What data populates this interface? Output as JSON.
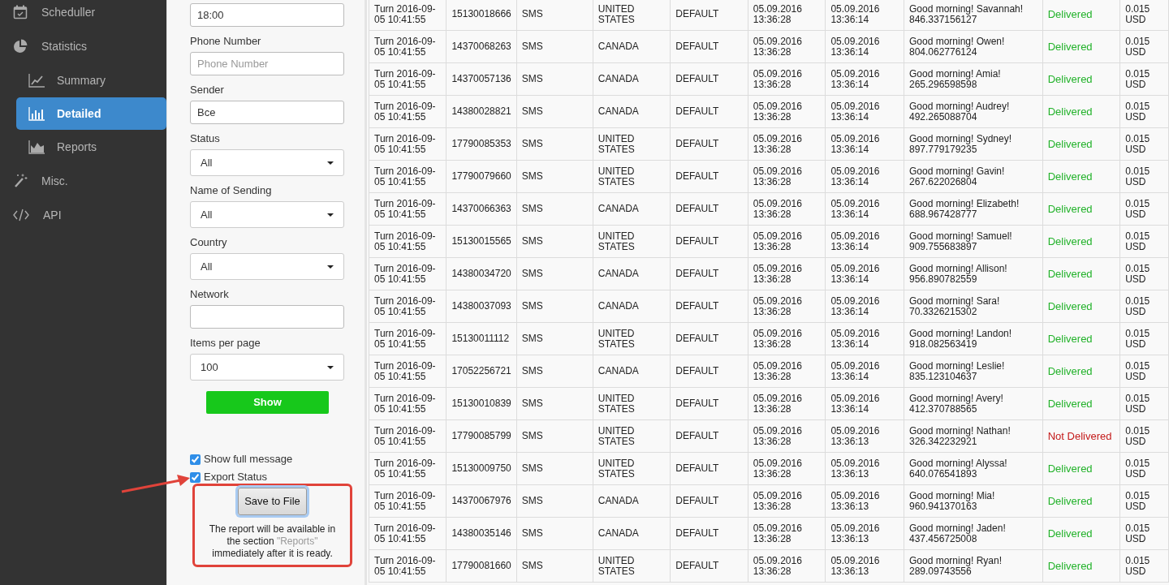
{
  "sidebar": {
    "items": [
      {
        "label": "Scheduller",
        "selected": false
      },
      {
        "label": "Statistics",
        "selected": false,
        "children": [
          {
            "label": "Summary",
            "selected": false
          },
          {
            "label": "Detailed",
            "selected": true
          },
          {
            "label": "Reports",
            "selected": false
          }
        ]
      },
      {
        "label": "Misc.",
        "selected": false
      },
      {
        "label": "API",
        "selected": false
      }
    ]
  },
  "filters": {
    "fields": [
      {
        "kind": "text",
        "value": "18:00"
      },
      {
        "kind": "text",
        "label": "Phone Number",
        "placeholder": "Phone Number"
      },
      {
        "kind": "text",
        "label": "Sender",
        "value": "Bce"
      },
      {
        "kind": "select",
        "label": "Status",
        "value": "All"
      },
      {
        "kind": "select",
        "label": "Name of Sending",
        "value": "All"
      },
      {
        "kind": "select",
        "label": "Country",
        "value": "All"
      },
      {
        "kind": "text",
        "label": "Network"
      },
      {
        "kind": "select",
        "label": "Items per page",
        "value": "100"
      }
    ],
    "show_button": "Show",
    "checkboxes": [
      {
        "label": "Show full message",
        "checked": true
      },
      {
        "label": "Export Status",
        "checked": true
      }
    ],
    "export": {
      "button": "Save to File",
      "note_before": "The report will be available in the section",
      "note_link": "\"Reports\"",
      "note_after": "immediately after it is ready."
    }
  },
  "table": {
    "rows": [
      {
        "kind": "delivered",
        "cells": [
          "Turn 2016-09-05 10:41:55",
          "15130018666",
          "SMS",
          "UNITED STATES",
          "DEFAULT",
          "05.09.2016 13:36:28",
          "05.09.2016 13:36:14",
          "Good morning! Savannah! 846.337156127",
          "Delivered",
          "0.015 USD"
        ]
      },
      {
        "kind": "delivered",
        "cells": [
          "Turn 2016-09-05 10:41:55",
          "14370068263",
          "SMS",
          "CANADA",
          "DEFAULT",
          "05.09.2016 13:36:28",
          "05.09.2016 13:36:14",
          "Good morning! Owen! 804.062776124",
          "Delivered",
          "0.015 USD"
        ]
      },
      {
        "kind": "delivered",
        "cells": [
          "Turn 2016-09-05 10:41:55",
          "14370057136",
          "SMS",
          "CANADA",
          "DEFAULT",
          "05.09.2016 13:36:28",
          "05.09.2016 13:36:14",
          "Good morning! Amia! 265.296598598",
          "Delivered",
          "0.015 USD"
        ]
      },
      {
        "kind": "delivered",
        "cells": [
          "Turn 2016-09-05 10:41:55",
          "14380028821",
          "SMS",
          "CANADA",
          "DEFAULT",
          "05.09.2016 13:36:28",
          "05.09.2016 13:36:14",
          "Good morning! Audrey! 492.265088704",
          "Delivered",
          "0.015 USD"
        ]
      },
      {
        "kind": "delivered",
        "cells": [
          "Turn 2016-09-05 10:41:55",
          "17790085353",
          "SMS",
          "UNITED STATES",
          "DEFAULT",
          "05.09.2016 13:36:28",
          "05.09.2016 13:36:14",
          "Good morning! Sydney! 897.779179235",
          "Delivered",
          "0.015 USD"
        ]
      },
      {
        "kind": "delivered",
        "cells": [
          "Turn 2016-09-05 10:41:55",
          "17790079660",
          "SMS",
          "UNITED STATES",
          "DEFAULT",
          "05.09.2016 13:36:28",
          "05.09.2016 13:36:14",
          "Good morning! Gavin! 267.622026804",
          "Delivered",
          "0.015 USD"
        ]
      },
      {
        "kind": "delivered",
        "cells": [
          "Turn 2016-09-05 10:41:55",
          "14370066363",
          "SMS",
          "CANADA",
          "DEFAULT",
          "05.09.2016 13:36:28",
          "05.09.2016 13:36:14",
          "Good morning! Elizabeth! 688.967428777",
          "Delivered",
          "0.015 USD"
        ]
      },
      {
        "kind": "delivered",
        "cells": [
          "Turn 2016-09-05 10:41:55",
          "15130015565",
          "SMS",
          "UNITED STATES",
          "DEFAULT",
          "05.09.2016 13:36:28",
          "05.09.2016 13:36:14",
          "Good morning! Samuel! 909.755683897",
          "Delivered",
          "0.015 USD"
        ]
      },
      {
        "kind": "delivered",
        "cells": [
          "Turn 2016-09-05 10:41:55",
          "14380034720",
          "SMS",
          "CANADA",
          "DEFAULT",
          "05.09.2016 13:36:28",
          "05.09.2016 13:36:14",
          "Good morning! Allison! 956.890782559",
          "Delivered",
          "0.015 USD"
        ]
      },
      {
        "kind": "delivered",
        "cells": [
          "Turn 2016-09-05 10:41:55",
          "14380037093",
          "SMS",
          "CANADA",
          "DEFAULT",
          "05.09.2016 13:36:28",
          "05.09.2016 13:36:14",
          "Good morning! Sara! 70.3326215302",
          "Delivered",
          "0.015 USD"
        ]
      },
      {
        "kind": "delivered",
        "cells": [
          "Turn 2016-09-05 10:41:55",
          "15130011112",
          "SMS",
          "UNITED STATES",
          "DEFAULT",
          "05.09.2016 13:36:28",
          "05.09.2016 13:36:14",
          "Good morning! Landon! 918.082563419",
          "Delivered",
          "0.015 USD"
        ]
      },
      {
        "kind": "delivered",
        "cells": [
          "Turn 2016-09-05 10:41:55",
          "17052256721",
          "SMS",
          "CANADA",
          "DEFAULT",
          "05.09.2016 13:36:28",
          "05.09.2016 13:36:14",
          "Good morning! Leslie! 835.123104637",
          "Delivered",
          "0.015 USD"
        ]
      },
      {
        "kind": "delivered",
        "cells": [
          "Turn 2016-09-05 10:41:55",
          "15130010839",
          "SMS",
          "UNITED STATES",
          "DEFAULT",
          "05.09.2016 13:36:28",
          "05.09.2016 13:36:14",
          "Good morning! Avery! 412.370788565",
          "Delivered",
          "0.015 USD"
        ]
      },
      {
        "kind": "not_delivered",
        "cells": [
          "Turn 2016-09-05 10:41:55",
          "17790085799",
          "SMS",
          "UNITED STATES",
          "DEFAULT",
          "05.09.2016 13:36:28",
          "05.09.2016 13:36:13",
          "Good morning! Nathan! 326.342232921",
          "Not Delivered",
          "0.015 USD"
        ]
      },
      {
        "kind": "delivered",
        "cells": [
          "Turn 2016-09-05 10:41:55",
          "15130009750",
          "SMS",
          "UNITED STATES",
          "DEFAULT",
          "05.09.2016 13:36:28",
          "05.09.2016 13:36:13",
          "Good morning! Alyssa! 640.076541893",
          "Delivered",
          "0.015 USD"
        ]
      },
      {
        "kind": "delivered",
        "cells": [
          "Turn 2016-09-05 10:41:55",
          "14370067976",
          "SMS",
          "CANADA",
          "DEFAULT",
          "05.09.2016 13:36:28",
          "05.09.2016 13:36:13",
          "Good morning! Mia! 960.941370163",
          "Delivered",
          "0.015 USD"
        ]
      },
      {
        "kind": "delivered",
        "cells": [
          "Turn 2016-09-05 10:41:55",
          "14380035146",
          "SMS",
          "CANADA",
          "DEFAULT",
          "05.09.2016 13:36:28",
          "05.09.2016 13:36:13",
          "Good morning! Jaden! 437.456725008",
          "Delivered",
          "0.015 USD"
        ]
      },
      {
        "kind": "delivered",
        "cells": [
          "Turn 2016-09-05 10:41:55",
          "17790081660",
          "SMS",
          "UNITED STATES",
          "DEFAULT",
          "05.09.2016 13:36:28",
          "05.09.2016 13:36:13",
          "Good morning! Ryan! 289.09743556",
          "Delivered",
          "0.015 USD"
        ]
      }
    ]
  }
}
